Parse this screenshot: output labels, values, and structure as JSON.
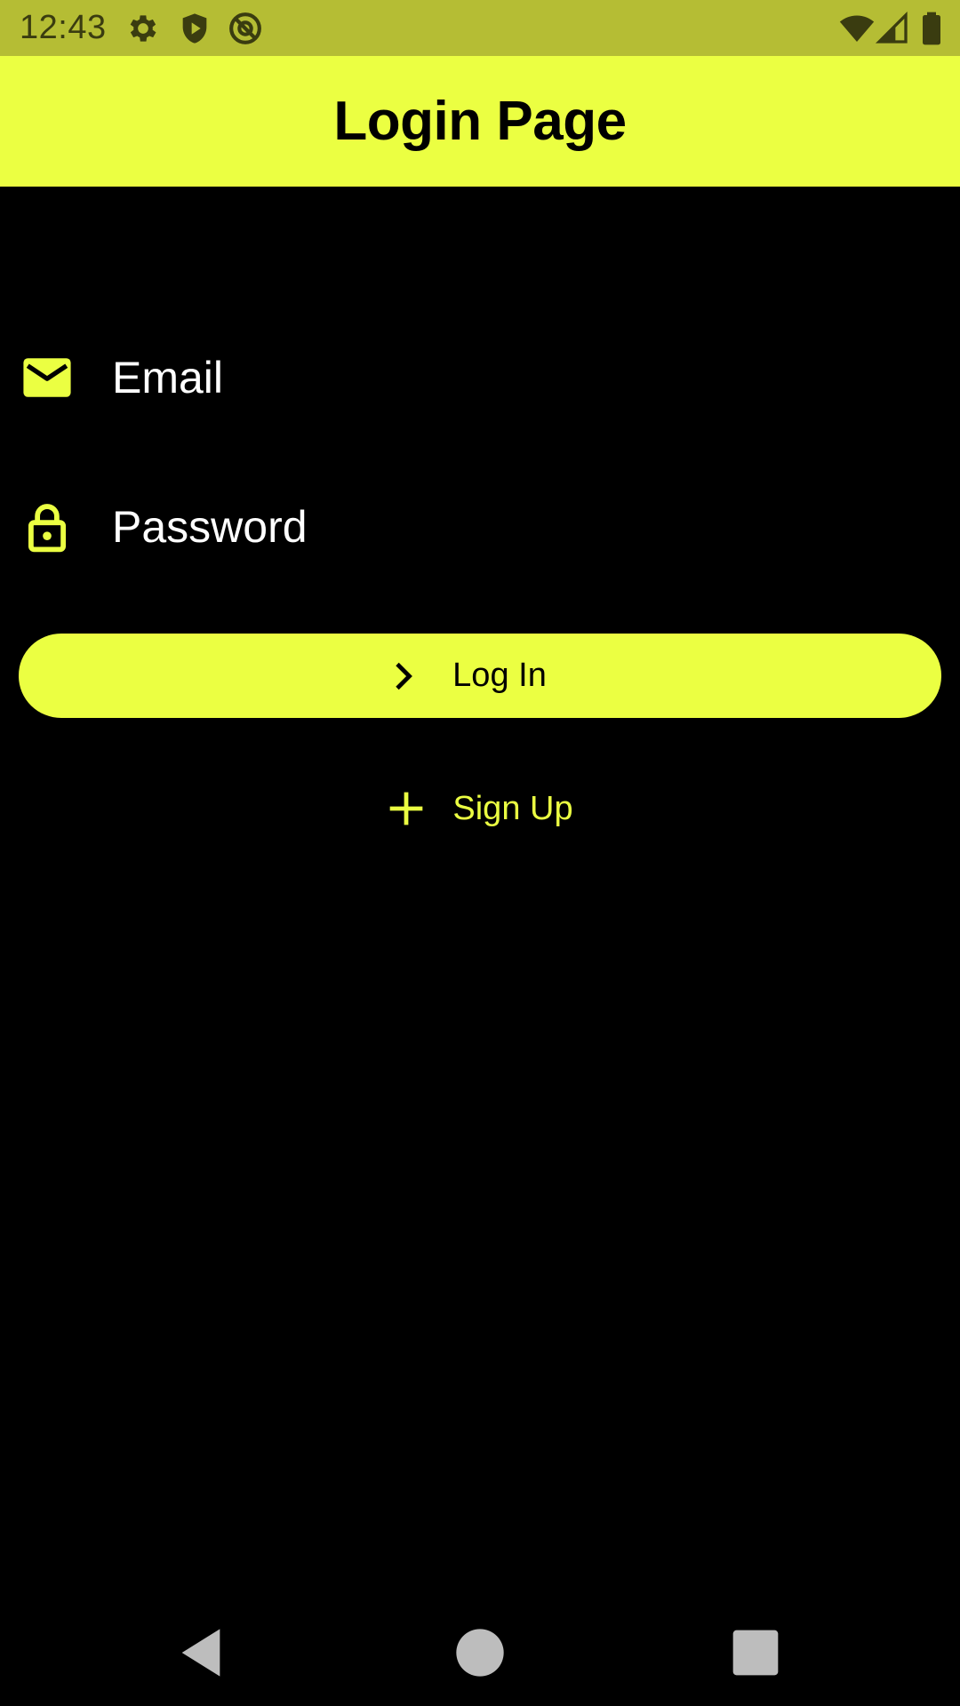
{
  "status_bar": {
    "time": "12:43",
    "icons": [
      "gear-icon",
      "shield-play-icon",
      "at-sign-icon",
      "wifi-icon",
      "signal-icon",
      "battery-icon"
    ],
    "background": "#b5bd34"
  },
  "app_bar": {
    "title": "Login Page",
    "background": "#ebff42"
  },
  "form": {
    "email": {
      "placeholder": "Email",
      "icon": "mail-icon"
    },
    "password": {
      "placeholder": "Password",
      "icon": "lock-icon"
    },
    "login_button": {
      "label": "Log In",
      "icon": "chevron-right-icon"
    },
    "signup_button": {
      "label": "Sign Up",
      "icon": "plus-icon"
    }
  },
  "nav_bar": {
    "buttons": [
      "back-icon",
      "home-icon",
      "recents-icon"
    ]
  },
  "colors": {
    "accent": "#ebff42",
    "background": "#000000",
    "text": "#ffffff"
  }
}
